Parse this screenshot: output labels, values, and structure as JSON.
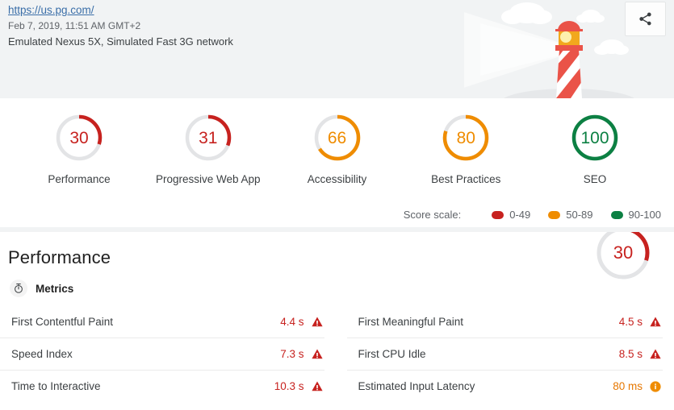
{
  "header": {
    "url": "https://us.pg.com/",
    "timestamp": "Feb 7, 2019, 11:51 AM GMT+2",
    "environment": "Emulated Nexus 5X, Simulated Fast 3G network",
    "share_icon": "share-icon",
    "illustration": "lighthouse-illustration"
  },
  "scores": {
    "gauges": [
      {
        "label": "Performance",
        "value": "30",
        "score": 30,
        "color": "#c7221f"
      },
      {
        "label": "Progressive Web App",
        "value": "31",
        "score": 31,
        "color": "#c7221f"
      },
      {
        "label": "Accessibility",
        "value": "66",
        "score": 66,
        "color": "#ef8c00"
      },
      {
        "label": "Best Practices",
        "value": "80",
        "score": 80,
        "color": "#ef8c00"
      },
      {
        "label": "SEO",
        "value": "100",
        "score": 100,
        "color": "#0c8043"
      }
    ],
    "scale": {
      "title": "Score scale:",
      "items": [
        {
          "label": "0-49",
          "color": "#c7221f"
        },
        {
          "label": "50-89",
          "color": "#ef8c00"
        },
        {
          "label": "90-100",
          "color": "#0c8043"
        }
      ]
    }
  },
  "performance": {
    "title": "Performance",
    "gauge": {
      "value": "30",
      "score": 30,
      "color": "#c7221f"
    },
    "metrics_section": {
      "label": "Metrics",
      "icon": "stopwatch-icon"
    },
    "metrics_left": [
      {
        "name": "First Contentful Paint",
        "value": "4.4 s",
        "status": "fail",
        "icon": "warning-triangle-icon"
      },
      {
        "name": "Speed Index",
        "value": "7.3 s",
        "status": "fail",
        "icon": "warning-triangle-icon"
      },
      {
        "name": "Time to Interactive",
        "value": "10.3 s",
        "status": "fail",
        "icon": "warning-triangle-icon"
      }
    ],
    "metrics_right": [
      {
        "name": "First Meaningful Paint",
        "value": "4.5 s",
        "status": "fail",
        "icon": "warning-triangle-icon"
      },
      {
        "name": "First CPU Idle",
        "value": "8.5 s",
        "status": "fail",
        "icon": "warning-triangle-icon"
      },
      {
        "name": "Estimated Input Latency",
        "value": "80 ms",
        "status": "avg",
        "icon": "info-circle-icon"
      }
    ]
  },
  "colors": {
    "fail": "#c7221f",
    "average": "#ef8c00",
    "pass": "#0c8043",
    "header_bg": "#f1f3f4",
    "track": "#e3e4e6",
    "lighthouse_red": "#ea5348",
    "lighthouse_light": "#f2a81d"
  }
}
